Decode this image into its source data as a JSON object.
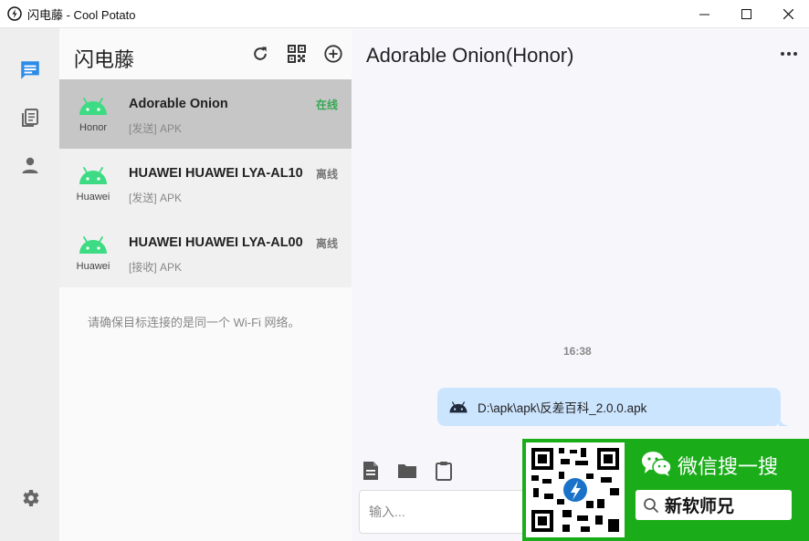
{
  "window": {
    "title": "闪电藤 - Cool Potato"
  },
  "rail": {
    "items": [
      {
        "name": "messages-icon",
        "active": true
      },
      {
        "name": "files-icon",
        "active": false
      },
      {
        "name": "contacts-icon",
        "active": false
      }
    ],
    "settings": "settings-icon"
  },
  "panel": {
    "title": "闪电藤",
    "actions": [
      "refresh-icon",
      "qr-code-icon",
      "add-circle-icon"
    ],
    "devices": [
      {
        "name": "Adorable Onion",
        "brand": "Honor",
        "status": "在线",
        "online": true,
        "subtitle": "[发送] APK"
      },
      {
        "name": "HUAWEI HUAWEI LYA-AL10",
        "brand": "Huawei",
        "status": "离线",
        "online": false,
        "subtitle": "[发送] APK"
      },
      {
        "name": "HUAWEI HUAWEI LYA-AL00",
        "brand": "Huawei",
        "status": "离线",
        "online": false,
        "subtitle": "[接收] APK"
      }
    ],
    "hint": "请确保目标连接的是同一个 Wi-Fi 网络。"
  },
  "chat": {
    "title": "Adorable Onion(Honor)",
    "time": "16:38",
    "message": "D:\\apk\\apk\\反差百科_2.0.0.apk",
    "input_placeholder": "输入...",
    "tools": [
      "document-icon",
      "folder-icon",
      "clipboard-icon"
    ]
  },
  "watermark": {
    "title": "微信搜一搜",
    "search_text": "新软师兄"
  },
  "colors": {
    "online": "#34a853",
    "accent": "#2b8be6",
    "android": "#3ddc84",
    "bubble": "#cce5ff",
    "wechat": "#1aad19"
  }
}
